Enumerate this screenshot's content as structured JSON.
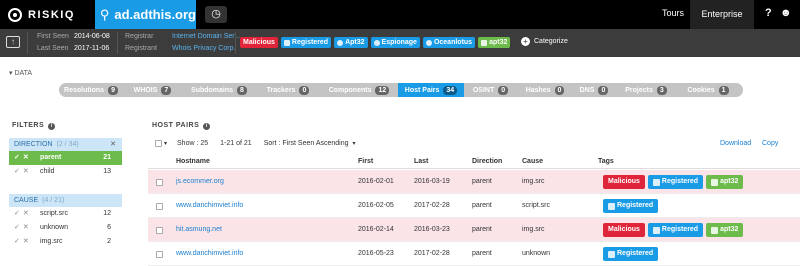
{
  "header": {
    "brand": "RISKIQ",
    "search_query": "ad.adthis.org",
    "tours": "Tours",
    "enterprise": "Enterprise"
  },
  "info": {
    "first_seen_label": "First Seen",
    "first_seen": "2014-06-08",
    "last_seen_label": "Last Seen",
    "last_seen": "2017-11-06",
    "registrar_label": "Registrar",
    "registrar": "Internet Domain Ser...",
    "registrant_label": "Registrant",
    "registrant": "Whois Privacy Corp.",
    "tags": [
      {
        "label": "Malicious",
        "color": "#e0253a",
        "icon": "none"
      },
      {
        "label": "Registered",
        "color": "#1a9be6",
        "icon": "registered-icon"
      },
      {
        "label": "Apt32",
        "color": "#1a9be6",
        "icon": "globe-icon"
      },
      {
        "label": "Espionage",
        "color": "#1a9be6",
        "icon": "globe-icon"
      },
      {
        "label": "Oceanlotus",
        "color": "#1a9be6",
        "icon": "globe-icon"
      },
      {
        "label": "apt32",
        "color": "#6dbb4a",
        "icon": "tag-icon"
      }
    ],
    "categorize": "Categorize"
  },
  "data_toggle": "DATA",
  "tabs": [
    {
      "label": "Resolutions",
      "count": "9"
    },
    {
      "label": "WHOIS",
      "count": "7"
    },
    {
      "label": "Subdomains",
      "count": "8"
    },
    {
      "label": "Trackers",
      "count": "0"
    },
    {
      "label": "Components",
      "count": "12"
    },
    {
      "label": "Host Pairs",
      "count": "34",
      "active": true
    },
    {
      "label": "OSINT",
      "count": "0"
    },
    {
      "label": "Hashes",
      "count": "0"
    },
    {
      "label": "DNS",
      "count": "0"
    },
    {
      "label": "Projects",
      "count": "3"
    },
    {
      "label": "Cookies",
      "count": "1"
    }
  ],
  "filters": {
    "title": "FILTERS",
    "direction": {
      "title": "DIRECTION",
      "sub": "(2 / 34)",
      "items": [
        {
          "label": "parent",
          "count": "21",
          "selected": true
        },
        {
          "label": "child",
          "count": "13"
        }
      ]
    },
    "cause": {
      "title": "CAUSE",
      "sub": "(4 / 21)",
      "items": [
        {
          "label": "script.src",
          "count": "12"
        },
        {
          "label": "unknown",
          "count": "6"
        },
        {
          "label": "img.src",
          "count": "2"
        }
      ]
    }
  },
  "hostpairs": {
    "title": "HOST PAIRS",
    "show": "Show : 25",
    "range": "1-21 of 21",
    "sort": "Sort : First Seen Ascending",
    "download": "Download",
    "copy": "Copy",
    "columns": [
      "Hostname",
      "First",
      "Last",
      "Direction",
      "Cause",
      "Tags"
    ],
    "rows": [
      {
        "host": "js.ecommer.org",
        "first": "2016-02-01",
        "last": "2016-03-19",
        "direction": "parent",
        "cause": "img.src",
        "highlight": true,
        "tags": [
          {
            "label": "Malicious",
            "color": "#e0253a",
            "icon": "none"
          },
          {
            "label": "Registered",
            "color": "#1a9be6",
            "icon": "registered-icon"
          },
          {
            "label": "apt32",
            "color": "#6dbb4a",
            "icon": "tag-icon"
          }
        ]
      },
      {
        "host": "www.danchimviet.info",
        "first": "2016-02-05",
        "last": "2017-02-28",
        "direction": "parent",
        "cause": "script.src",
        "highlight": false,
        "tags": [
          {
            "label": "Registered",
            "color": "#1a9be6",
            "icon": "registered-icon"
          }
        ]
      },
      {
        "host": "hit.asmung.net",
        "first": "2016-02-14",
        "last": "2016-03-23",
        "direction": "parent",
        "cause": "img.src",
        "highlight": true,
        "tags": [
          {
            "label": "Malicious",
            "color": "#e0253a",
            "icon": "none"
          },
          {
            "label": "Registered",
            "color": "#1a9be6",
            "icon": "registered-icon"
          },
          {
            "label": "apt32",
            "color": "#6dbb4a",
            "icon": "tag-icon"
          }
        ]
      },
      {
        "host": "www.danchimviet.info",
        "first": "2016-05-23",
        "last": "2017-02-28",
        "direction": "parent",
        "cause": "unknown",
        "highlight": false,
        "tags": [
          {
            "label": "Registered",
            "color": "#1a9be6",
            "icon": "registered-icon"
          }
        ]
      }
    ]
  }
}
